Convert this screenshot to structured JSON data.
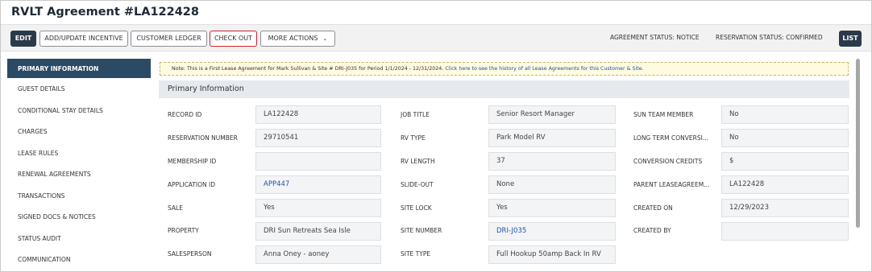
{
  "title": "RVLT Agreement #LA122428",
  "toolbar": {
    "edit_label": "EDIT",
    "add_incentive_label": "ADD/UPDATE INCENTIVE",
    "customer_ledger_label": "CUSTOMER LEDGER",
    "check_out_label": "CHECK OUT",
    "more_actions_label": "MORE ACTIONS",
    "agreement_status": "AGREEMENT STATUS: NOTICE",
    "reservation_status": "RESERVATION STATUS: CONFIRMED",
    "list_label": "LIST"
  },
  "sidebar": {
    "items": [
      {
        "label": "PRIMARY INFORMATION"
      },
      {
        "label": "GUEST DETAILS"
      },
      {
        "label": "CONDITIONAL STAY DETAILS"
      },
      {
        "label": "CHARGES"
      },
      {
        "label": "LEASE RULES"
      },
      {
        "label": "RENEWAL AGREEMENTS"
      },
      {
        "label": "TRANSACTIONS"
      },
      {
        "label": "SIGNED DOCS & NOTICES"
      },
      {
        "label": "STATUS AUDIT"
      },
      {
        "label": "COMMUNICATION"
      }
    ]
  },
  "note": {
    "text": "Note:  This is a First Lease Agreement for Mark Sullivan & Site # DRI-J035 for Period 1/1/2024 - 12/31/2024. ",
    "link": "Click here to see the history of all Lease Agreements for this Customer & Site."
  },
  "section_title": "Primary Information",
  "fields": {
    "col1": [
      {
        "label": "RECORD ID",
        "value": "LA122428"
      },
      {
        "label": "RESERVATION NUMBER",
        "value": "29710541"
      },
      {
        "label": "MEMBERSHIP ID",
        "value": ""
      },
      {
        "label": "APPLICATION ID",
        "value": "APP447"
      },
      {
        "label": "SALE",
        "value": "Yes"
      },
      {
        "label": "PROPERTY",
        "value": "DRI Sun Retreats Sea Isle"
      },
      {
        "label": "SALESPERSON",
        "value": "Anna Oney - aoney"
      }
    ],
    "col2": [
      {
        "label": "JOB TITLE",
        "value": "Senior Resort Manager"
      },
      {
        "label": "RV TYPE",
        "value": "Park Model RV"
      },
      {
        "label": "RV LENGTH",
        "value": "37"
      },
      {
        "label": "SLIDE-OUT",
        "value": "None"
      },
      {
        "label": "SITE LOCK",
        "value": "Yes"
      },
      {
        "label": "SITE NUMBER",
        "value": "DRI-J035"
      },
      {
        "label": "SITE TYPE",
        "value": "Full Hookup 50amp Back In RV"
      }
    ],
    "col3": [
      {
        "label": "SUN TEAM MEMBER",
        "value": "No"
      },
      {
        "label": "LONG TERM CONVERSI...",
        "value": "No"
      },
      {
        "label": "CONVERSION CREDITS",
        "value": "$"
      },
      {
        "label": "PARENT LEASEAGREEM...",
        "value": "LA122428"
      },
      {
        "label": "CREATED ON",
        "value": "12/29/2023"
      },
      {
        "label": "CREATED BY",
        "value": ""
      }
    ]
  }
}
